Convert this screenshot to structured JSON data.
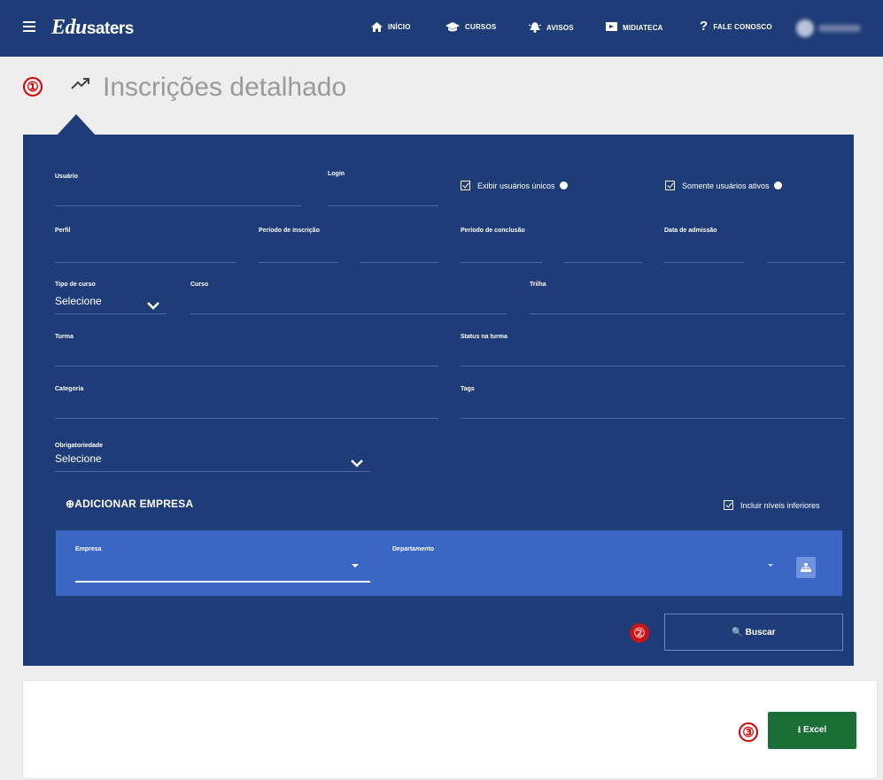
{
  "app": {
    "logo_italic": "Edu",
    "logo_bold": "saters"
  },
  "nav": [
    {
      "icon": "home-icon",
      "label": "INÍCIO"
    },
    {
      "icon": "graduation-cap-icon",
      "label": "CURSOS"
    },
    {
      "icon": "bell-icon",
      "label": "AVISOS"
    },
    {
      "icon": "media-icon",
      "label": "MIDIATECA"
    },
    {
      "icon": "question-icon",
      "label": "FALE CONOSCO"
    }
  ],
  "page": {
    "title": "Inscrições detalhado",
    "step_markers": [
      "①",
      "②",
      "③"
    ]
  },
  "filters": {
    "user_label": "Usuário",
    "login_label": "Login",
    "show_unique_label": "Exibir usuários únicos",
    "only_active_label": "Somente usuários ativos",
    "profile_label": "Perfil",
    "enrollment_period_label": "Período de inscrição",
    "completion_period_label": "Período de conclusão",
    "admission_date_label": "Data de admissão",
    "course_type_label": "Tipo de curso",
    "course_type_value": "Selecione",
    "course_label": "Curso",
    "track_label": "Trilha",
    "class_label": "Turma",
    "class_status_label": "Status na turma",
    "category_label": "Categoria",
    "tags_label": "Tags",
    "mandatory_label": "Obrigatoriedade",
    "mandatory_value": "Selecione",
    "add_company_label": "⊕ADICIONAR EMPRESA",
    "include_lower_label": "Incluir níveis inferiores",
    "company_label": "Empresa",
    "department_label": "Departamento",
    "search_label": "🔍 Buscar"
  },
  "results": {
    "excel_label": "⭳ Excel"
  },
  "colors": {
    "primary": "#1e3c78",
    "company_box": "#3a66c4",
    "excel": "#1a6f37",
    "marker": "#d40000"
  }
}
